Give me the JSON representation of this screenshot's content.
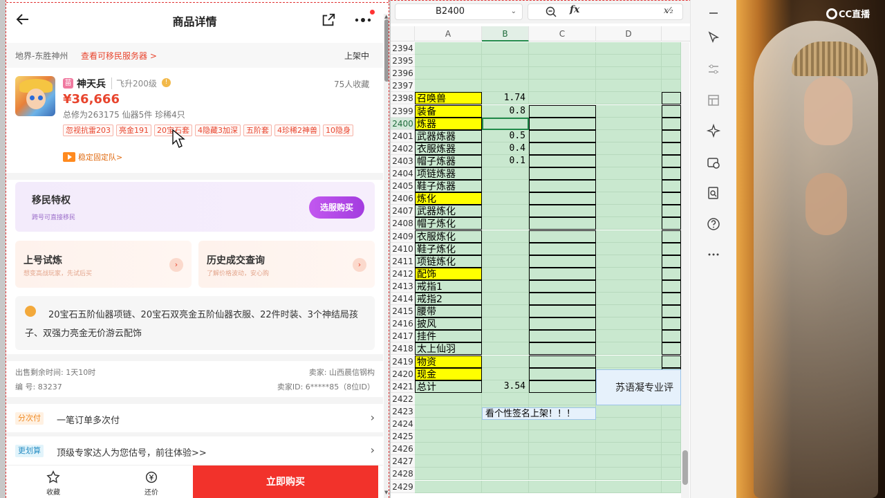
{
  "phone": {
    "header": {
      "title": "商品详情"
    },
    "server": {
      "name": "地界-东胜神州",
      "link": "查看可移民服务器 >",
      "status": "上架中"
    },
    "product": {
      "badge": "苗",
      "name": "神天兵",
      "level": "飞升200级",
      "favorites": "75人收藏",
      "price": "¥36,666",
      "stats": "总修为263175  仙器5件  珍稀4只",
      "tags": [
        "忽视抗雷203",
        "亮金191",
        "20宝石套",
        "4隐藏3加深",
        "五阶套",
        "4珍稀2神兽",
        "10隐身"
      ],
      "guarantee": "稳定固定队>"
    },
    "migrate": {
      "title": "移民特权",
      "subtitle": "跨号可直接移民",
      "button": "选服购买"
    },
    "trial": {
      "title": "上号试炼",
      "subtitle": "想变高战玩家，先试后买"
    },
    "history": {
      "title": "历史成交查询",
      "subtitle": "了解价格波动，安心购"
    },
    "description": "20宝石五阶仙器项链、20宝石双亮金五阶仙器衣服、22件时装、3个神结局孩子、双强力亮金无价游云配饰",
    "meta": {
      "remaining": "出售剩余时间: 1天10时",
      "seller": "卖家: 山西晨信钢构",
      "number": "编 号: 83237",
      "seller_id": "卖家ID: 6*****85（8位ID）"
    },
    "options": [
      {
        "badge": "分次付",
        "text": "一笔订单多次付"
      },
      {
        "badge": "更划算",
        "text": "顶级专家达人为您估号，前往体验>>"
      }
    ],
    "bottom": {
      "fav_label": "收藏",
      "bargain_label": "还价",
      "buy_label": "立即购买"
    }
  },
  "sheet": {
    "namebox": "B2400",
    "fx_label": "fx",
    "columns": [
      "A",
      "B",
      "C",
      "D"
    ],
    "rows": [
      {
        "n": "2394",
        "a": "",
        "b": ""
      },
      {
        "n": "2395",
        "a": "",
        "b": ""
      },
      {
        "n": "2396",
        "a": "",
        "b": ""
      },
      {
        "n": "2397",
        "a": "",
        "b": ""
      },
      {
        "n": "2398",
        "a": "召唤兽",
        "b": "1.74",
        "hl": true
      },
      {
        "n": "2399",
        "a": "装备",
        "b": "0.8",
        "hl": true
      },
      {
        "n": "2400",
        "a": "炼器",
        "b": "",
        "hl": true,
        "active": true
      },
      {
        "n": "2401",
        "a": "武器炼器",
        "b": "0.5"
      },
      {
        "n": "2402",
        "a": "衣服炼器",
        "b": "0.4"
      },
      {
        "n": "2403",
        "a": "帽子炼器",
        "b": "0.1"
      },
      {
        "n": "2404",
        "a": "项链炼器",
        "b": ""
      },
      {
        "n": "2405",
        "a": "鞋子炼器",
        "b": ""
      },
      {
        "n": "2406",
        "a": "炼化",
        "b": "",
        "hl": true
      },
      {
        "n": "2407",
        "a": "武器炼化",
        "b": ""
      },
      {
        "n": "2408",
        "a": "帽子炼化",
        "b": ""
      },
      {
        "n": "2409",
        "a": "衣服炼化",
        "b": ""
      },
      {
        "n": "2410",
        "a": "鞋子炼化",
        "b": ""
      },
      {
        "n": "2411",
        "a": "项链炼化",
        "b": ""
      },
      {
        "n": "2412",
        "a": "配饰",
        "b": "",
        "hl": true
      },
      {
        "n": "2413",
        "a": "戒指1",
        "b": ""
      },
      {
        "n": "2414",
        "a": "戒指2",
        "b": ""
      },
      {
        "n": "2415",
        "a": "腰带",
        "b": ""
      },
      {
        "n": "2416",
        "a": "披风",
        "b": ""
      },
      {
        "n": "2417",
        "a": "挂件",
        "b": ""
      },
      {
        "n": "2418",
        "a": "太上仙羽",
        "b": ""
      },
      {
        "n": "2419",
        "a": "物资",
        "b": "",
        "hl": true
      },
      {
        "n": "2420",
        "a": "现金",
        "b": "",
        "hl": true
      },
      {
        "n": "2421",
        "a": "总计",
        "b": "3.54"
      },
      {
        "n": "2422",
        "a": "",
        "b": ""
      },
      {
        "n": "2423",
        "a": "",
        "b": ""
      },
      {
        "n": "2424",
        "a": "",
        "b": ""
      },
      {
        "n": "2425",
        "a": "",
        "b": ""
      },
      {
        "n": "2426",
        "a": "",
        "b": ""
      },
      {
        "n": "2427",
        "a": "",
        "b": ""
      },
      {
        "n": "2428",
        "a": "",
        "b": ""
      },
      {
        "n": "2429",
        "a": "",
        "b": ""
      }
    ],
    "banner": "苏语凝专业评",
    "sign": "看个性签名上架！！！"
  },
  "photo": {
    "logo": "CC直播"
  },
  "colors": {
    "accent_red": "#f2322b",
    "price_red": "#e8452e",
    "purple": "#a33cdf",
    "sheet_green": "#c9e8cf",
    "highlight_yellow": "#ffff00"
  }
}
